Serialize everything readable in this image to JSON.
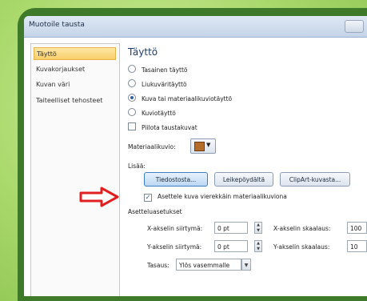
{
  "window": {
    "title": "Muotoile tausta"
  },
  "sidebar": {
    "items": [
      {
        "label": "Täyttö",
        "active": true
      },
      {
        "label": "Kuvakorjaukset",
        "active": false
      },
      {
        "label": "Kuvan väri",
        "active": false
      },
      {
        "label": "Taiteelliset tehosteet",
        "active": false
      }
    ]
  },
  "main": {
    "heading": "Täyttö",
    "fill_options": [
      {
        "label": "Tasainen täyttö",
        "selected": false
      },
      {
        "label": "Liukuväritäyttö",
        "selected": false
      },
      {
        "label": "Kuva tai materiaalikuviotäyttö",
        "selected": true
      },
      {
        "label": "Kuviotäyttö",
        "selected": false
      }
    ],
    "hide_background": {
      "label": "Piilota taustakuvat",
      "checked": false
    },
    "texture": {
      "label": "Materiaalikuvio:",
      "icon": "wood-texture-icon"
    },
    "insert": {
      "label": "Lisää:",
      "file_button": "Tiedostosta...",
      "clipboard_button": "Leikepöydältä",
      "clipart_button": "ClipArt-kuvasta..."
    },
    "tile": {
      "label": "Asettele kuva vierekkäin materiaalikuviona",
      "checked": true
    },
    "tiling_options": {
      "heading": "Asetteluasetukset",
      "x_offset_label": "X-akselin siirtymä:",
      "x_offset_value": "0 pt",
      "y_offset_label": "Y-akselin siirtymä:",
      "y_offset_value": "0 pt",
      "x_scale_label": "X-akselin skaalaus:",
      "x_scale_value": "100",
      "y_scale_label": "Y-akselin skaalaus:",
      "y_scale_value": "10",
      "align_label": "Tasaus:",
      "align_value": "Ylös vasemmalle"
    }
  },
  "colors": {
    "background": "#a8d86a",
    "frame": "#3f7a2a",
    "arrow": "#e02020",
    "accent": "#3c7fc6"
  }
}
